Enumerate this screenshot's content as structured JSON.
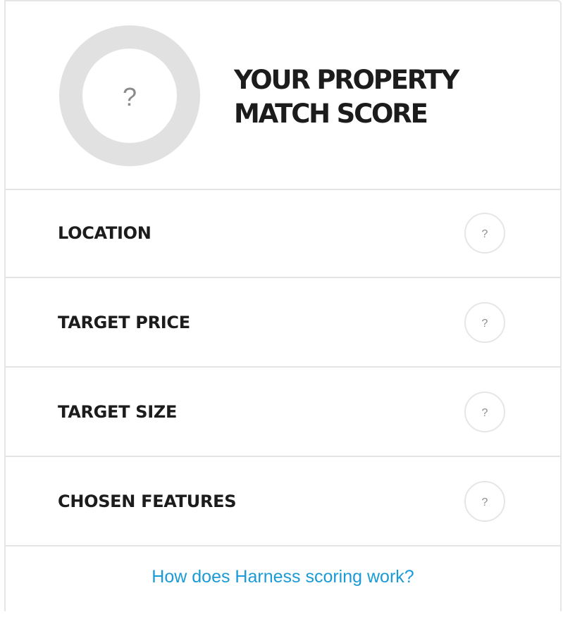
{
  "score": {
    "value": "?",
    "title_line1": "YOUR PROPERTY",
    "title_line2": "MATCH SCORE"
  },
  "criteria": [
    {
      "label": "LOCATION",
      "score": "?"
    },
    {
      "label": "TARGET PRICE",
      "score": "?"
    },
    {
      "label": "TARGET SIZE",
      "score": "?"
    },
    {
      "label": "CHOSEN FEATURES",
      "score": "?"
    }
  ],
  "footer": {
    "link_text": "How does Harness scoring work?"
  },
  "colors": {
    "ring": "#e1e1e1",
    "heading": "#1c1c1c",
    "link": "#1a9ad6",
    "divider": "#e4e4e4"
  }
}
